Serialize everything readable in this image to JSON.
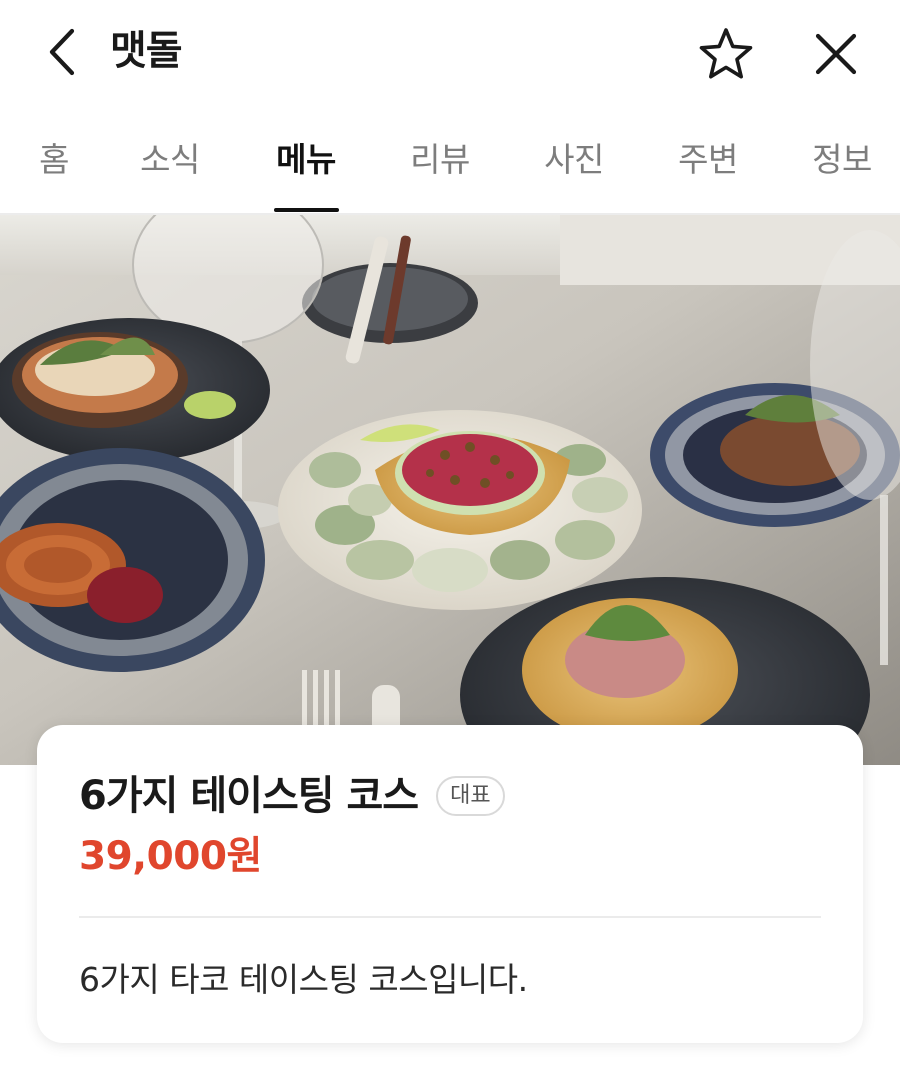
{
  "header": {
    "title": "맷돌",
    "back_icon": "chevron-left-icon",
    "favorite_icon": "star-outline-icon",
    "close_icon": "close-icon"
  },
  "tabs": [
    {
      "label": "홈",
      "active": false
    },
    {
      "label": "소식",
      "active": false
    },
    {
      "label": "메뉴",
      "active": true
    },
    {
      "label": "리뷰",
      "active": false
    },
    {
      "label": "사진",
      "active": false
    },
    {
      "label": "주변",
      "active": false
    },
    {
      "label": "정보",
      "active": false
    }
  ],
  "menu_item": {
    "name": "6가지 테이스팅 코스",
    "badge": "대표",
    "price": "39,000원",
    "description": "6가지 타코 테이스팅 코스입니다.",
    "price_color": "#e0462d"
  }
}
